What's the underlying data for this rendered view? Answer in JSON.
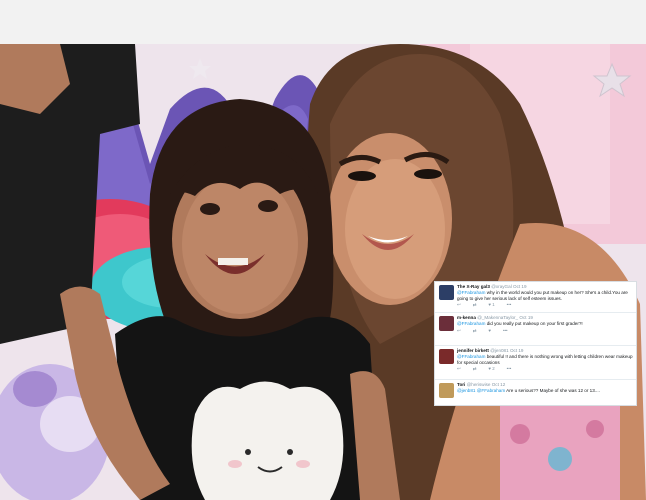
{
  "tweets": [
    {
      "name": "The X-Ray gal3",
      "handle": "@xrayGal",
      "time": "Oct 19",
      "mention": "@FFabraham",
      "text": "why in the world would you put makeup on her? She's a child.You are going to give her serious lack of self esteem issues.",
      "reply": "",
      "retweets": "",
      "likes": "1",
      "more": "•••",
      "avatar_color": "#2c3e66"
    },
    {
      "name": "m-kenna",
      "handle": "@_MakennaTaylor_",
      "time": "Oct 19",
      "mention": "@FFabraham",
      "text": "did you really put makeup on your first grader?!",
      "reply": "",
      "retweets": "",
      "likes": "",
      "more": "•••",
      "avatar_color": "#6b2e3a"
    },
    {
      "name": "jennifer birkett",
      "handle": "@jen081",
      "time": "Oct 19",
      "mention": "@FFabraham",
      "text": "beautiful !! and there is nothing wrong with letting children wear makeup for special occasions",
      "reply": "",
      "retweets": "",
      "likes": "2",
      "more": "•••",
      "avatar_color": "#7a2a2a"
    },
    {
      "name": "Tori",
      "handle": "@heriswise",
      "time": "Oct 12",
      "mention": "@jenb81 @FFabraham",
      "text": "Are u serious?? Maybe of she was 12 or 13....",
      "reply": "",
      "retweets": "",
      "likes": "",
      "more": "",
      "avatar_color": "#c09a5a"
    }
  ]
}
